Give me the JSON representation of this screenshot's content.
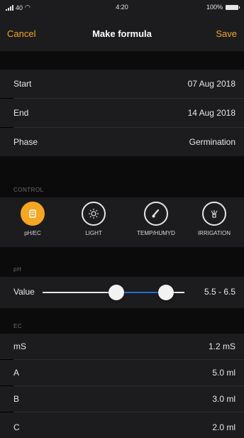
{
  "status": {
    "carrier": "40",
    "time": "4:20",
    "battery": "100%"
  },
  "nav": {
    "cancel": "Cancel",
    "title": "Make formula",
    "save": "Save"
  },
  "dates": [
    {
      "label": "Start",
      "value": "07 Aug 2018"
    },
    {
      "label": "End",
      "value": "14 Aug 2018"
    },
    {
      "label": "Phase",
      "value": "Germination"
    }
  ],
  "control": {
    "header": "CONTROL",
    "items": [
      {
        "label": "pH/EC",
        "icon": "ph-ec-icon",
        "active": true
      },
      {
        "label": "LIGHT",
        "icon": "sun-icon",
        "active": false
      },
      {
        "label": "TEMP/HUMYD",
        "icon": "thermometer-icon",
        "active": false
      },
      {
        "label": "IRRIGATION",
        "icon": "irrigation-icon",
        "active": false
      }
    ]
  },
  "ph": {
    "header": "pH",
    "label": "Value",
    "range_text": "5.5 - 6.5",
    "range_low": 5.5,
    "range_high": 6.5
  },
  "ec": {
    "header": "EC",
    "rows": [
      {
        "label": "mS",
        "value": "1.2 mS"
      },
      {
        "label": "A",
        "value": "5.0 ml"
      },
      {
        "label": "B",
        "value": "3.0 ml"
      },
      {
        "label": "C",
        "value": "2.0 ml"
      }
    ]
  },
  "colors": {
    "accent": "#f5a623",
    "cell": "#1c1c1e",
    "background": "#0b0b0b",
    "slider_active": "#1f6fd6"
  }
}
